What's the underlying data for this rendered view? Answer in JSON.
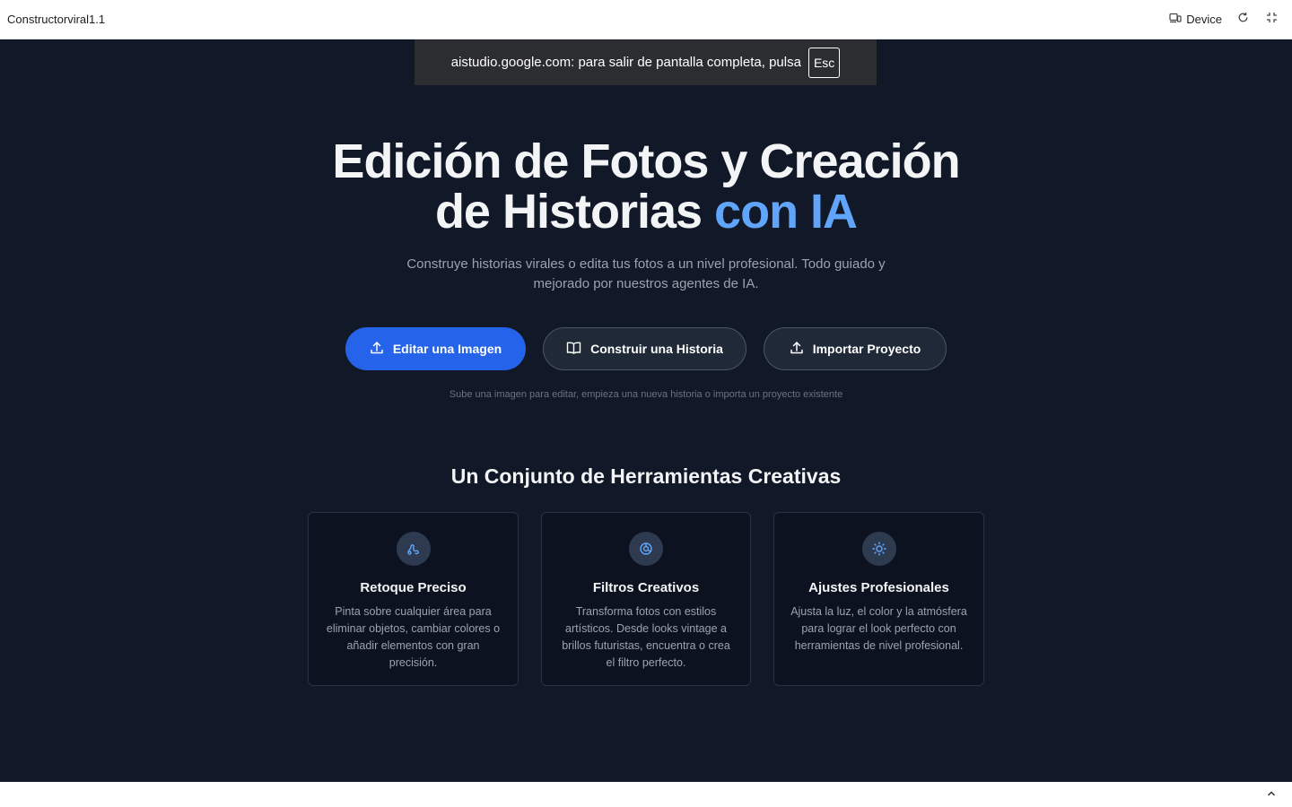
{
  "app": {
    "title": "Constructorviral1.1",
    "device_label": "Device"
  },
  "fullscreen_notice": {
    "text": "aistudio.google.com: para salir de pantalla completa, pulsa",
    "key": "Esc"
  },
  "hero": {
    "title_line1": "Edición de Fotos y Creación",
    "title_line2_plain": "de Historias ",
    "title_line2_accent": "con IA",
    "subtitle": "Construye historias virales o edita tus fotos a un nivel profesional. Todo guiado y mejorado por nuestros agentes de IA."
  },
  "actions": {
    "edit_image": "Editar una Imagen",
    "build_story": "Construir una Historia",
    "import_project": "Importar Proyecto",
    "hint": "Sube una imagen para editar, empieza una nueva historia o importa un proyecto existente"
  },
  "tools": {
    "heading": "Un Conjunto de Herramientas Creativas",
    "cards": [
      {
        "icon": "brush-icon",
        "title": "Retoque Preciso",
        "description": "Pinta sobre cualquier área para eliminar objetos, cambiar colores o añadir elementos con gran precisión."
      },
      {
        "icon": "palette-icon",
        "title": "Filtros Creativos",
        "description": "Transforma fotos con estilos artísticos. Desde looks vintage a brillos futuristas, encuentra o crea el filtro perfecto."
      },
      {
        "icon": "sun-icon",
        "title": "Ajustes Profesionales",
        "description": "Ajusta la luz, el color y la atmósfera para lograr el look perfecto con herramientas de nivel profesional."
      }
    ]
  },
  "colors": {
    "background": "#111827",
    "accent": "#60a5fa",
    "primary_button": "#2563eb"
  }
}
